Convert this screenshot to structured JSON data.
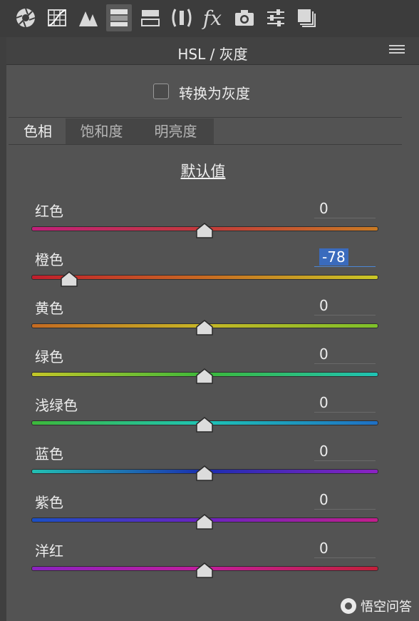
{
  "toolbar": {
    "icons": [
      {
        "name": "basic-aperture-icon",
        "active": false
      },
      {
        "name": "tone-curve-grid-icon",
        "active": false
      },
      {
        "name": "detail-triangles-icon",
        "active": false
      },
      {
        "name": "hsl-grayscale-icon",
        "active": true
      },
      {
        "name": "split-toning-icon",
        "active": false
      },
      {
        "name": "lens-corrections-icon",
        "active": false
      },
      {
        "name": "effects-fx-icon",
        "active": false
      },
      {
        "name": "camera-calibration-icon",
        "active": false
      },
      {
        "name": "presets-sliders-icon",
        "active": false
      },
      {
        "name": "snapshots-stack-icon",
        "active": false
      }
    ],
    "fx_label": "fx"
  },
  "panel": {
    "title": "HSL / 灰度",
    "grayscale_label": "转换为灰度",
    "grayscale_checked": false,
    "tabs": [
      {
        "label": "色相",
        "active": true
      },
      {
        "label": "饱和度",
        "active": false
      },
      {
        "label": "明亮度",
        "active": false
      }
    ],
    "default_label": "默认值",
    "range": [
      -100,
      100
    ],
    "sliders": [
      {
        "label": "红色",
        "value": "0",
        "selected": false,
        "colors": [
          "#c0207a",
          "#c23a3a",
          "#c87a24"
        ]
      },
      {
        "label": "橙色",
        "value": "-78",
        "selected": true,
        "colors": [
          "#c01e2c",
          "#c86a22",
          "#c9c826"
        ]
      },
      {
        "label": "黄色",
        "value": "0",
        "selected": false,
        "colors": [
          "#c46a22",
          "#c6b626",
          "#7dc02a"
        ]
      },
      {
        "label": "绿色",
        "value": "0",
        "selected": false,
        "colors": [
          "#c4c628",
          "#3cb83a",
          "#1fc2b4"
        ]
      },
      {
        "label": "浅绿色",
        "value": "0",
        "selected": false,
        "colors": [
          "#3db83b",
          "#1ec3b5",
          "#1f6fc4"
        ]
      },
      {
        "label": "蓝色",
        "value": "0",
        "selected": false,
        "colors": [
          "#22c0b2",
          "#1a2db0",
          "#8c22c2"
        ]
      },
      {
        "label": "紫色",
        "value": "0",
        "selected": false,
        "colors": [
          "#1a4fc4",
          "#6b22c0",
          "#c21e8c"
        ]
      },
      {
        "label": "洋红",
        "value": "0",
        "selected": false,
        "colors": [
          "#8a22c0",
          "#c21e9c",
          "#c2203a"
        ]
      }
    ]
  },
  "watermark": {
    "text": "悟空问答"
  }
}
